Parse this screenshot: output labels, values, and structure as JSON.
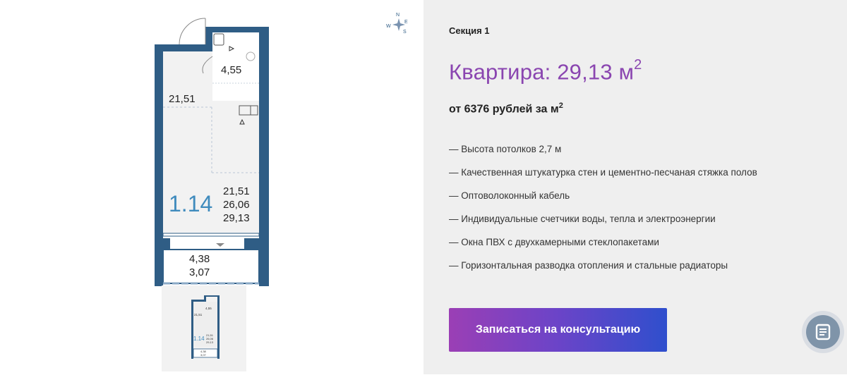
{
  "compass": {
    "n": "N",
    "e": "E",
    "w": "W",
    "s": "S"
  },
  "plan": {
    "area_room": "21,51",
    "area_bath": "4,55",
    "apt_number": "1.14",
    "totals": [
      "21,51",
      "26,06",
      "29,13"
    ],
    "balcony": [
      "4,38",
      "3,07"
    ]
  },
  "thumb": {
    "area_bath": "4,55",
    "area_room": "21,51",
    "apt_number": "1.14",
    "totals": [
      "21,51",
      "26,06",
      "29,13"
    ],
    "balcony": [
      "4,38",
      "3,07"
    ]
  },
  "info": {
    "section": "Секция 1",
    "title_prefix": "Квартира: 29,13 м",
    "title_sup": "2",
    "price_prefix": "от 6376 рублей за м",
    "price_sup": "2",
    "features": [
      "— Высота потолков 2,7 м",
      "— Качественная штукатурка стен и цементно-песчаная стяжка полов",
      "— Оптоволоконный кабель",
      "— Индивидуальные счетчики воды, тепла и электроэнергии",
      "— Окна ПВХ с двухкамерными стеклопакетами",
      "— Горизонтальная разводка отопления и стальные радиаторы"
    ],
    "cta_label": "Записаться на консультацию"
  },
  "colors": {
    "wall": "#2f5d85",
    "title": "#8a45b0",
    "cta_start": "#9b3fb5",
    "cta_end": "#2f4fcd",
    "chat": "#7f94a9"
  },
  "icons": {
    "chat": "document-chat-icon",
    "compass": "compass-rose-icon"
  }
}
